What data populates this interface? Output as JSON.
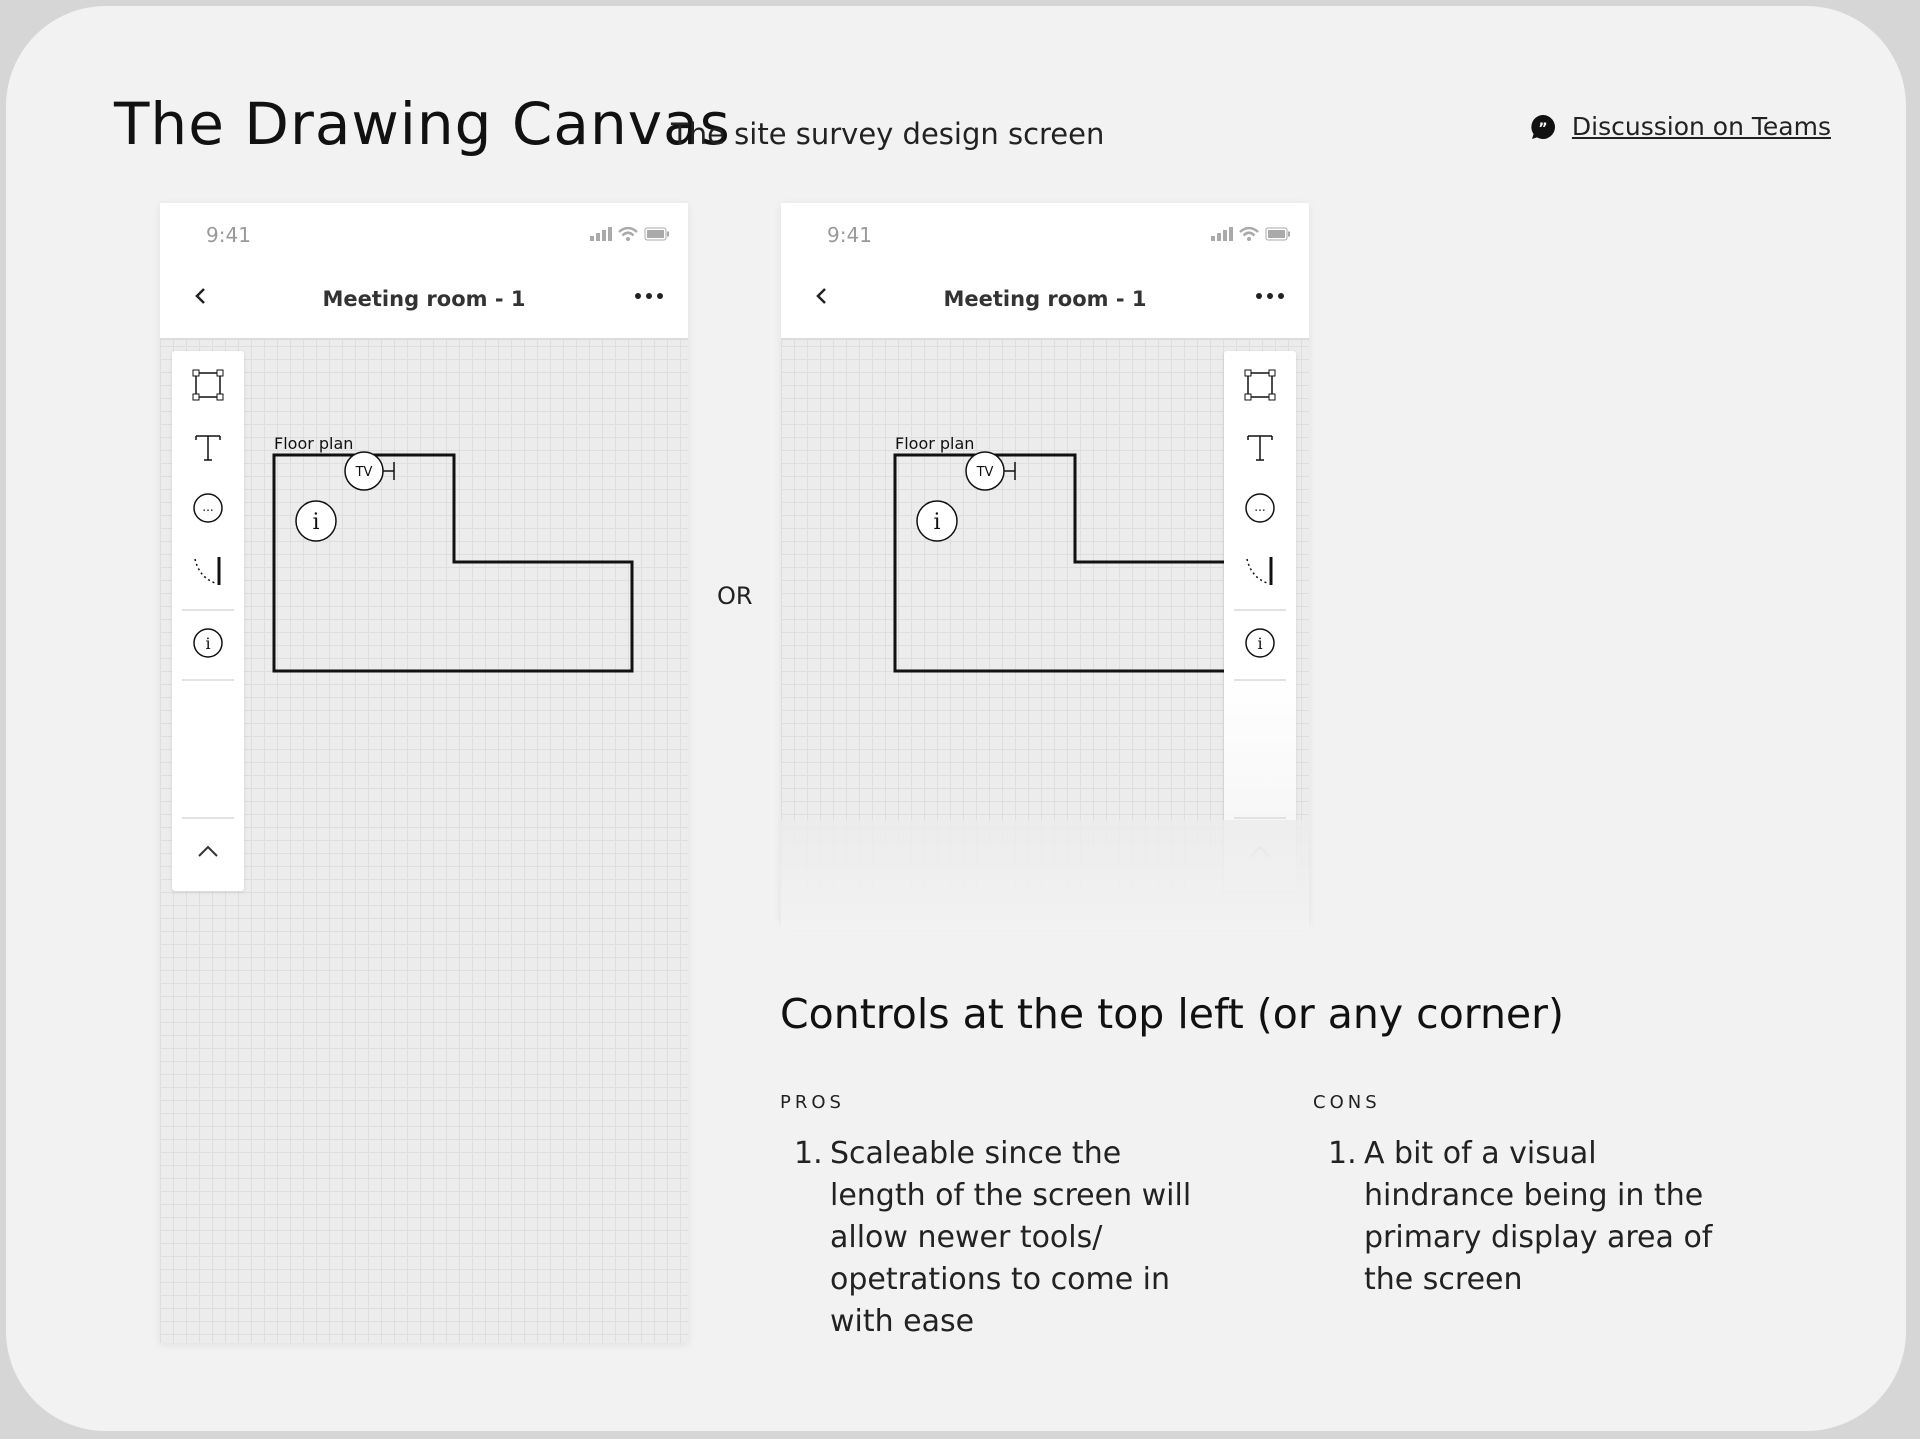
{
  "header": {
    "title": "The Drawing Canvas",
    "subtitle": "The site survey design screen",
    "discussion_link": "Discussion on Teams"
  },
  "phone": {
    "time": "9:41",
    "nav_title": "Meeting room - 1",
    "floor_label": "Floor plan",
    "tv_label": "TV",
    "info_glyph": "i",
    "comment_glyph": "..."
  },
  "icons": {
    "toolbar": [
      "rectangle-select-icon",
      "text-icon",
      "comment-icon",
      "door-icon",
      "info-icon",
      "chevron-up-icon"
    ],
    "nav": [
      "chevron-left-icon",
      "more-horizontal-icon"
    ],
    "status": [
      "signal-icon",
      "wifi-icon",
      "battery-icon"
    ]
  },
  "separator": "OR",
  "section": {
    "heading": "Controls at the top left (or any corner)",
    "pros_label": "PROS",
    "cons_label": "CONS",
    "pros_items": [
      "Scaleable since the length of the screen will allow newer tools/ opetrations to come in with ease"
    ],
    "cons_items": [
      "A bit of a visual hindrance being in the primary display area of the screen"
    ],
    "pros_number": "1.",
    "cons_number": "1."
  }
}
